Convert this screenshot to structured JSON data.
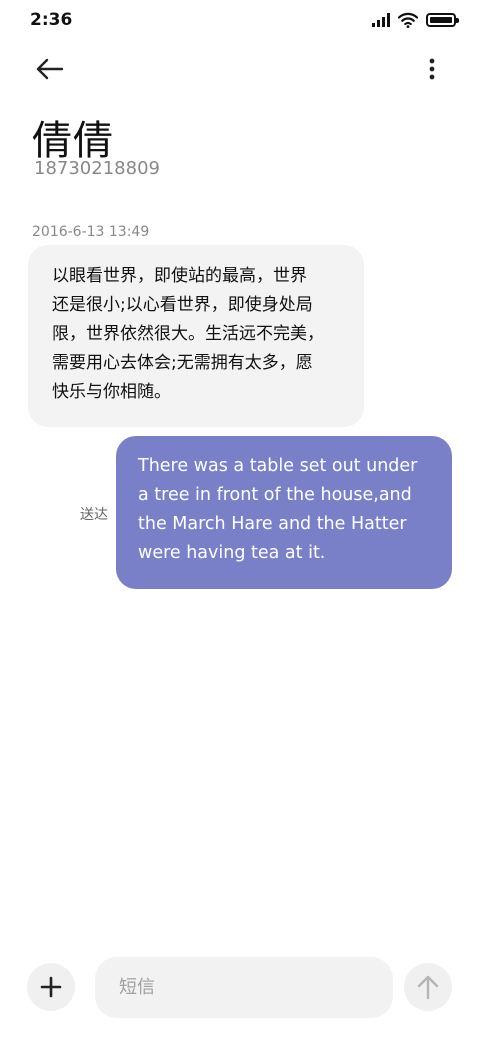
{
  "status_bar": {
    "time": "2:36",
    "icons": [
      "signal-icon",
      "wifi-icon",
      "battery-icon"
    ]
  },
  "header": {
    "back_icon": "arrow-left-icon",
    "more_icon": "more-vertical-icon",
    "contact_name": "倩倩",
    "contact_number": "18730218809"
  },
  "conversation": {
    "timestamp": "2016-6-13 13:49",
    "incoming": {
      "lines": [
        "以眼看世界，即使站的最高，世界",
        "还是很小;以心看世界，即使身处局",
        "限，世界依然很大。生活远不完美，",
        "需要用心去体会;无需拥有太多，愿",
        "快乐与你相随。"
      ]
    },
    "outgoing": {
      "lines": [
        "There was a table set out under",
        "a tree in front of the house,and",
        "the March Hare and the Hatter",
        "were having tea at it."
      ],
      "status": "送达"
    }
  },
  "composer": {
    "add_icon": "plus-icon",
    "placeholder": "短信",
    "value": "",
    "send_icon": "arrow-up-icon"
  },
  "colors": {
    "incoming_bubble": "#f3f3f3",
    "outgoing_bubble": "#7a80c8",
    "secondary_text": "#888888"
  }
}
